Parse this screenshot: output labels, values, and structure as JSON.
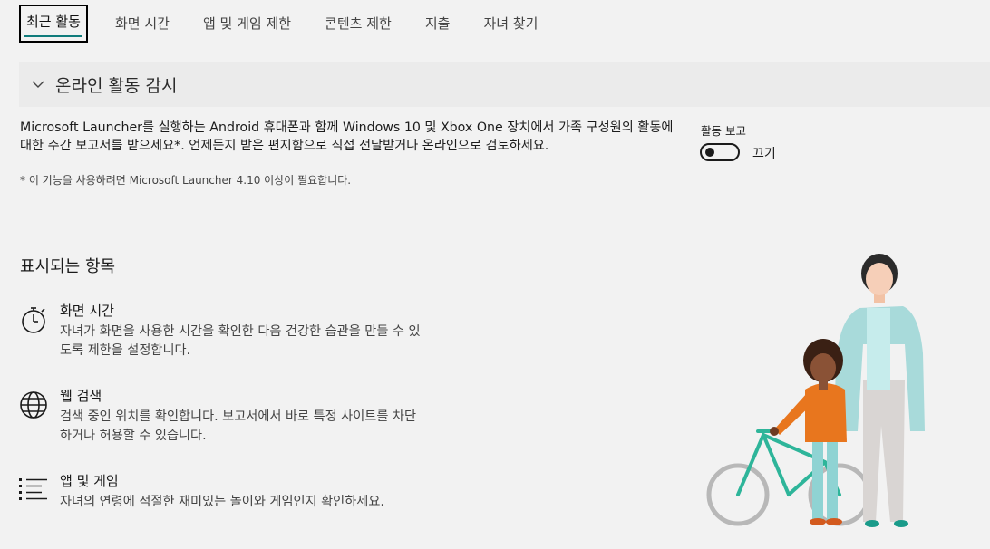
{
  "tabs": [
    {
      "label": "최근 활동",
      "active": true
    },
    {
      "label": "화면 시간"
    },
    {
      "label": "앱 및 게임 제한"
    },
    {
      "label": "콘텐츠 제한"
    },
    {
      "label": "지출"
    },
    {
      "label": "자녀 찾기"
    }
  ],
  "section": {
    "title": "온라인 활동 감시",
    "description": "Microsoft Launcher를 실행하는 Android 휴대폰과 함께 Windows 10 및 Xbox One 장치에서 가족 구성원의 활동에 대한 주간 보고서를 받으세요*. 언제든지 받은 편지함으로 직접 전달받거나 온라인으로 검토하세요.",
    "note": "* 이 기능을 사용하려면 Microsoft Launcher 4.10 이상이 필요합니다.",
    "report_label": "활동 보고",
    "toggle_state": "끄기"
  },
  "shown": {
    "title": "표시되는 항목",
    "items": [
      {
        "title": "화면 시간",
        "text": "자녀가 화면을 사용한 시간을 확인한 다음 건강한 습관을 만들 수 있도록 제한을 설정합니다.",
        "icon": "stopwatch-icon"
      },
      {
        "title": "웹 검색",
        "text": "검색 중인 위치를 확인합니다. 보고서에서 바로 특정 사이트를 차단하거나 허용할 수 있습니다.",
        "icon": "globe-icon"
      },
      {
        "title": "앱 및 게임",
        "text": "자녀의 연령에 적절한 재미있는 놀이와 게임인지 확인하세요.",
        "icon": "list-icon"
      }
    ]
  },
  "colors": {
    "accent": "#107c7c",
    "background": "#f2f2f2"
  }
}
